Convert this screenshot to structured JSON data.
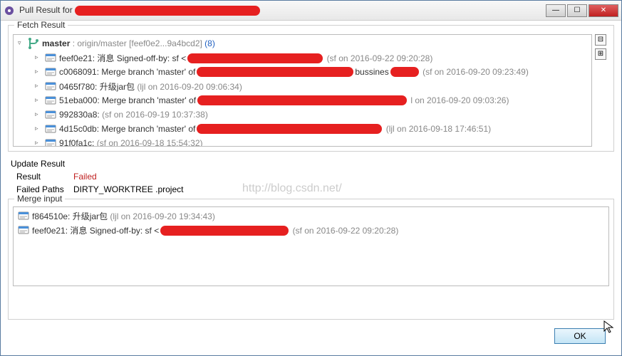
{
  "window": {
    "title_prefix": "Pull Result for"
  },
  "fetch": {
    "label": "Fetch Result",
    "root": {
      "branch": "master",
      "tracking": ": origin/master",
      "range": "[feef0e2...9a4bcd2]",
      "count": "(8)"
    },
    "commits": [
      {
        "hash": "feef0e21:",
        "msg": "消息 Signed-off-by: sf <",
        "meta": "(sf on 2016-09-22 09:20:28)",
        "rw": 190
      },
      {
        "hash": "c0068091:",
        "msg": "Merge branch 'master' of",
        "mid": "bussines",
        "meta": "(sf on 2016-09-20 09:23:49)",
        "rw": 220,
        "rw2": 40
      },
      {
        "hash": "0465f780:",
        "msg": "升级jar包",
        "meta": "(ljl on 2016-09-20 09:06:34)"
      },
      {
        "hash": "51eba000:",
        "msg": "Merge branch 'master' of",
        "meta": "l on 2016-09-20 09:03:26)",
        "rw": 294
      },
      {
        "hash": "992830a8:",
        "msg": "",
        "meta": "(sf on 2016-09-19 10:37:38)"
      },
      {
        "hash": "4d15c0db:",
        "msg": "Merge branch 'master' of",
        "meta": "(ljl on 2016-09-18 17:46:51)",
        "rw": 260
      },
      {
        "hash": "91f0fa1c:",
        "msg": "",
        "meta": "(sf on 2016-09-18 15:54:32)"
      }
    ]
  },
  "update": {
    "label": "Update Result",
    "result_label": "Result",
    "result_value": "Failed",
    "paths_label": "Failed Paths",
    "paths_value": "DIRTY_WORKTREE .project"
  },
  "merge": {
    "label": "Merge input",
    "items": [
      {
        "hash": "f864510e:",
        "msg": "升级jar包",
        "meta": "(ljl on 2016-09-20 19:34:43)"
      },
      {
        "hash": "feef0e21:",
        "msg": "消息 Signed-off-by: sf <",
        "meta": "(sf on 2016-09-22 09:20:28)",
        "rw": 180
      }
    ]
  },
  "footer": {
    "ok": "OK"
  },
  "watermark": "http://blog.csdn.net/"
}
